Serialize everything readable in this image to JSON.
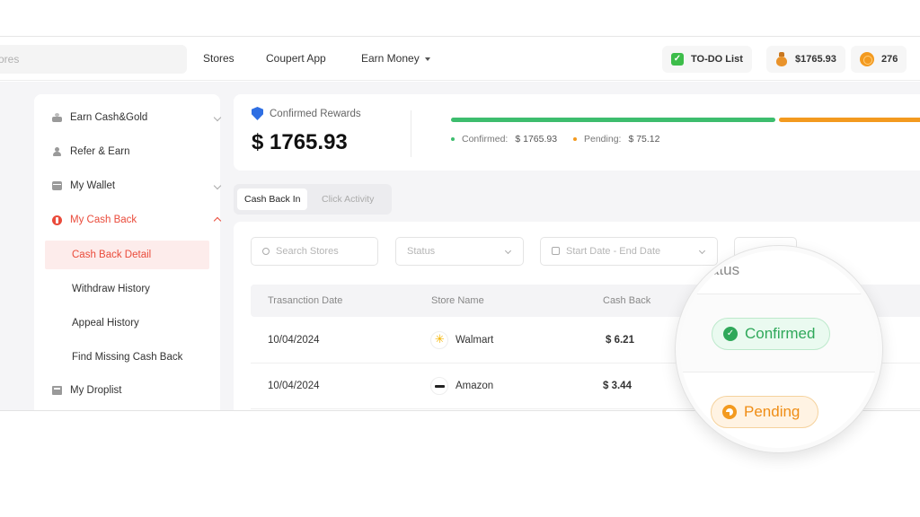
{
  "topbar": {
    "search_placeholder": "ores",
    "nav": [
      "Stores",
      "Coupert App",
      "Earn Money"
    ],
    "todo_label": "TO-DO List",
    "balance": "$1765.93",
    "coins": "276"
  },
  "sidebar": {
    "items": [
      {
        "label": "Earn Cash&Gold",
        "icon": "hand-coin-icon"
      },
      {
        "label": "Refer & Earn",
        "icon": "person-icon"
      },
      {
        "label": "My Wallet",
        "icon": "wallet-icon"
      },
      {
        "label": "My Cash Back",
        "icon": "cashback-icon"
      }
    ],
    "sub_items": [
      "Cash Back Detail",
      "Withdraw History",
      "Appeal History",
      "Find Missing Cash Back"
    ],
    "droplist": "My Droplist"
  },
  "rewards": {
    "label": "Confirmed Rewards",
    "amount": "$ 1765.93",
    "confirmed_label": "Confirmed:",
    "confirmed_value": "$ 1765.93",
    "pending_label": "Pending:",
    "pending_value": "$ 75.12",
    "colors": {
      "confirmed": "#3dbd6e",
      "pending": "#f39a1f"
    }
  },
  "tabs": [
    "Cash Back In",
    "Click Activity"
  ],
  "filters": {
    "search_placeholder": "Search Stores",
    "status_placeholder": "Status",
    "date_placeholder": "Start Date - End Date"
  },
  "table": {
    "headers": [
      "Trasanction Date",
      "Store Name",
      "Cash Back"
    ],
    "rows": [
      {
        "date": "10/04/2024",
        "store": "Walmart",
        "cashback": "$ 6.21"
      },
      {
        "date": "10/04/2024",
        "store": "Amazon",
        "cashback": "$ 3.44"
      }
    ]
  },
  "magnifier": {
    "status_header": "atus",
    "confirmed": "Confirmed",
    "pending": "Pending"
  }
}
